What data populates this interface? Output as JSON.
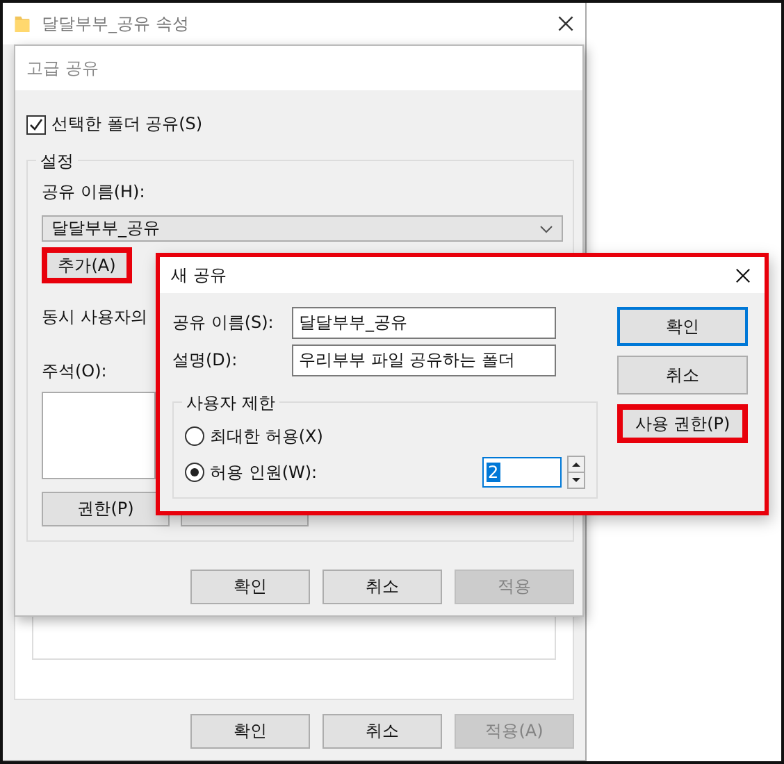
{
  "properties_window": {
    "title": "달달부부_공유 속성",
    "buttons": [
      {
        "label": "확인",
        "disabled": false
      },
      {
        "label": "취소",
        "disabled": false
      },
      {
        "label": "적용(A)",
        "disabled": true
      }
    ]
  },
  "advanced_sharing": {
    "title": "고급 공유",
    "share_checkbox": {
      "label": "선택한 폴더 공유(S)",
      "checked": true
    },
    "settings_group": "설정",
    "share_name_label": "공유 이름(H):",
    "share_name": "달달부부_공유",
    "add_button": {
      "label": "추가(A)",
      "highlighted": true
    },
    "user_limit_label": "동시 사용자의",
    "comments_label": "주석(O):",
    "permissions_button": "권한(P)",
    "buttons": [
      {
        "label": "확인",
        "disabled": false
      },
      {
        "label": "취소",
        "disabled": false
      },
      {
        "label": "적용",
        "disabled": true
      }
    ]
  },
  "new_share": {
    "title": "새 공유",
    "highlighted": true,
    "share_name_label": "공유 이름(S):",
    "share_name": "달달부부_공유",
    "description_label": "설명(D):",
    "description": "우리부부 파일 공유하는 폴더",
    "user_limit_group": "사용자 제한",
    "options": [
      {
        "label": "최대한 허용(X)",
        "selected": false
      },
      {
        "label": "허용 인원(W):",
        "selected": true
      }
    ],
    "allowed_users": "2",
    "buttons": [
      {
        "label": "확인",
        "kind": "default",
        "highlighted": false
      },
      {
        "label": "취소",
        "kind": "normal",
        "highlighted": false
      },
      {
        "label": "사용 권한(P)",
        "kind": "normal",
        "highlighted": true
      }
    ]
  }
}
